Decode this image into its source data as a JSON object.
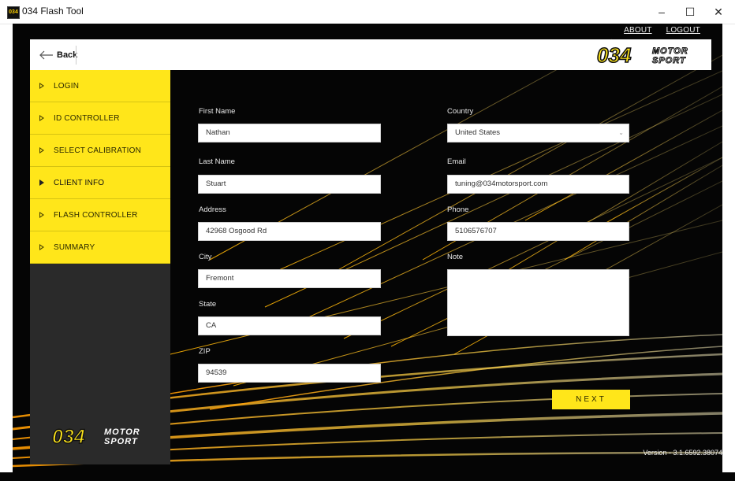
{
  "window": {
    "title": "034 Flash Tool",
    "icon_text": "034",
    "minimize_glyph": "–",
    "maximize_glyph": "☐",
    "close_glyph": "✕"
  },
  "top_links": {
    "about": "ABOUT",
    "logout": "LOGOUT"
  },
  "header": {
    "back_label": "Back"
  },
  "brand": {
    "logo_main": "034",
    "logo_top": "MOTOR",
    "logo_bottom": "SPORT",
    "accent": "#ffe61a"
  },
  "sidebar": {
    "items": [
      {
        "label": "LOGIN",
        "state": "done"
      },
      {
        "label": "ID CONTROLLER",
        "state": "done"
      },
      {
        "label": "SELECT CALIBRATION",
        "state": "done"
      },
      {
        "label": "CLIENT INFO",
        "state": "active"
      },
      {
        "label": "FLASH CONTROLLER",
        "state": "pending"
      },
      {
        "label": "SUMMARY",
        "state": "pending"
      }
    ]
  },
  "form": {
    "first_name": {
      "label": "First Name",
      "value": "Nathan"
    },
    "last_name": {
      "label": "Last Name",
      "value": "Stuart"
    },
    "address": {
      "label": "Address",
      "value": "42968 Osgood Rd"
    },
    "city": {
      "label": "City",
      "value": "Fremont"
    },
    "state": {
      "label": "State",
      "value": "CA"
    },
    "zip": {
      "label": "ZIP",
      "value": "94539"
    },
    "country": {
      "label": "Country",
      "value": "United States"
    },
    "email": {
      "label": "Email",
      "value": "tuning@034motorsport.com"
    },
    "phone": {
      "label": "Phone",
      "value": "5106576707"
    },
    "note": {
      "label": "Note",
      "value": ""
    },
    "next_label": "NEXT"
  },
  "footer": {
    "version": "Version - 3.1.6592.38074"
  }
}
